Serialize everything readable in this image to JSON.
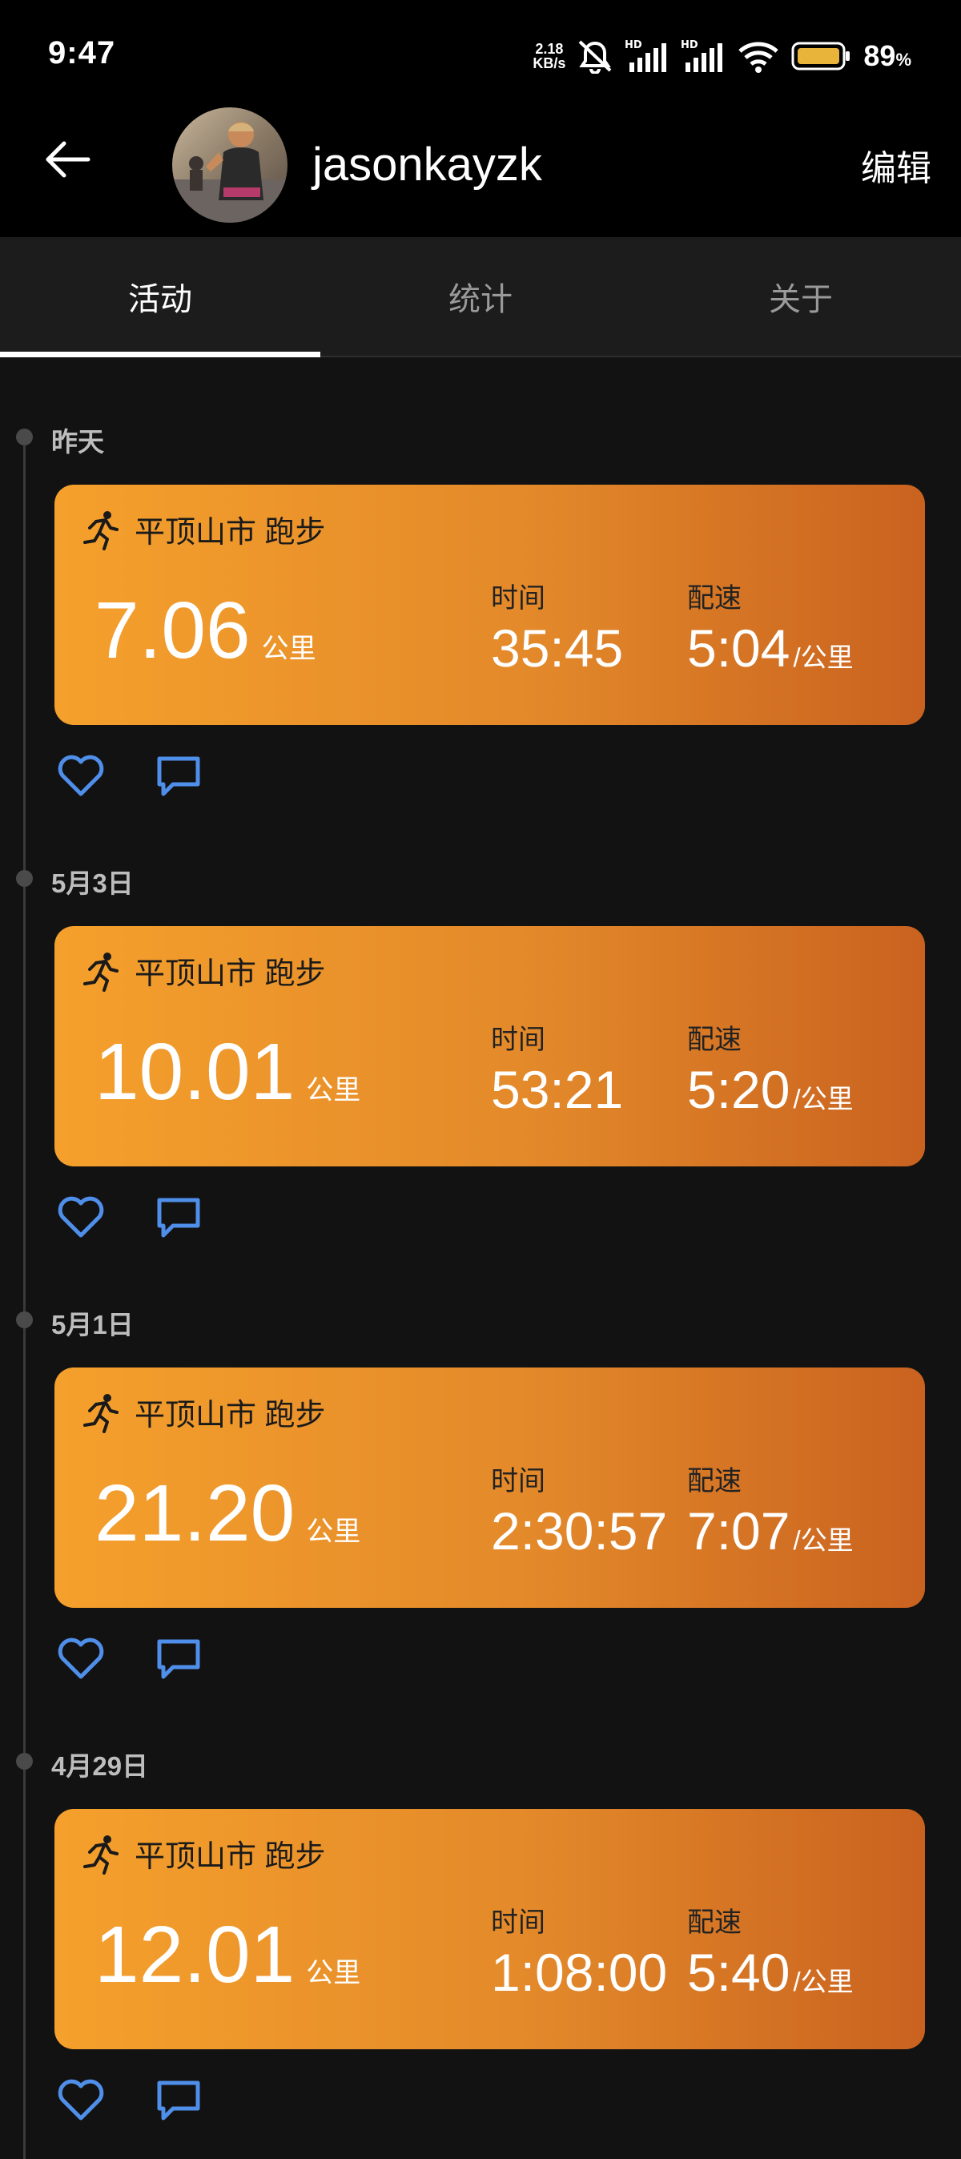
{
  "status_bar": {
    "time": "9:47",
    "net_speed_value": "2.18",
    "net_speed_unit": "KB/s",
    "battery_percent": "89",
    "battery_symbol": "%",
    "icons": [
      "mute-bell-icon",
      "signal-hd-icon",
      "signal-hd-icon",
      "wifi-icon",
      "battery-icon"
    ]
  },
  "header": {
    "username": "jasonkayzk",
    "edit_label": "编辑",
    "back_icon": "back-arrow-icon"
  },
  "tabs": [
    {
      "label": "活动",
      "active": true
    },
    {
      "label": "统计",
      "active": false
    },
    {
      "label": "关于",
      "active": false
    }
  ],
  "activities": [
    {
      "date": "昨天",
      "title": "平顶山市 跑步",
      "distance": "7.06",
      "distance_unit": "公里",
      "time_label": "时间",
      "time": "35:45",
      "pace_label": "配速",
      "pace": "5:04",
      "pace_unit": "/公里"
    },
    {
      "date": "5月3日",
      "title": "平顶山市 跑步",
      "distance": "10.01",
      "distance_unit": "公里",
      "time_label": "时间",
      "time": "53:21",
      "pace_label": "配速",
      "pace": "5:20",
      "pace_unit": "/公里"
    },
    {
      "date": "5月1日",
      "title": "平顶山市 跑步",
      "distance": "21.20",
      "distance_unit": "公里",
      "time_label": "时间",
      "time": "2:30:57",
      "pace_label": "配速",
      "pace": "7:07",
      "pace_unit": "/公里"
    },
    {
      "date": "4月29日",
      "title": "平顶山市 跑步",
      "distance": "12.01",
      "distance_unit": "公里",
      "time_label": "时间",
      "time": "1:08:00",
      "pace_label": "配速",
      "pace": "5:40",
      "pace_unit": "/公里"
    }
  ],
  "colors": {
    "card_gradient_start": "#f5a02c",
    "card_gradient_end": "#c9621f",
    "action_icon": "#4f8fea",
    "background": "#121212"
  }
}
